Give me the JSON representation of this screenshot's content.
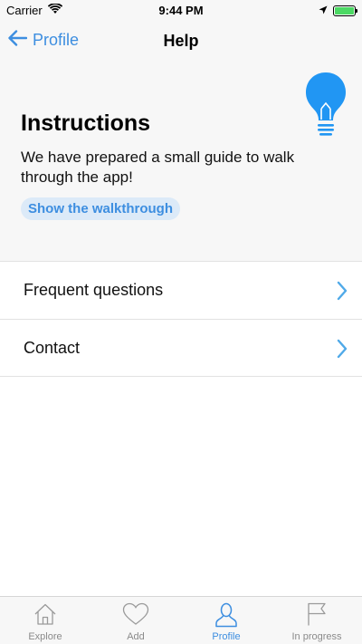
{
  "status_bar": {
    "carrier": "Carrier",
    "time": "9:44 PM",
    "battery_level": 1.0
  },
  "nav": {
    "back_label": "Profile",
    "title": "Help"
  },
  "instructions": {
    "title": "Instructions",
    "text": "We have prepared a small guide to walk through the app!",
    "button_label": "Show the walkthrough",
    "icon": "lightbulb-icon"
  },
  "list": {
    "items": [
      {
        "label": "Frequent questions",
        "icon": "chevron-right-icon"
      },
      {
        "label": "Contact",
        "icon": "chevron-right-icon"
      }
    ]
  },
  "tabs": [
    {
      "label": "Explore",
      "icon": "home-icon",
      "active": false
    },
    {
      "label": "Add",
      "icon": "heart-icon",
      "active": false
    },
    {
      "label": "Profile",
      "icon": "person-icon",
      "active": true
    },
    {
      "label": "In progress",
      "icon": "flag-icon",
      "active": false
    }
  ],
  "colors": {
    "accent": "#3d8ee0",
    "bulb": "#2196f3",
    "chevron": "#4fa9e8",
    "battery": "#4cd964"
  }
}
